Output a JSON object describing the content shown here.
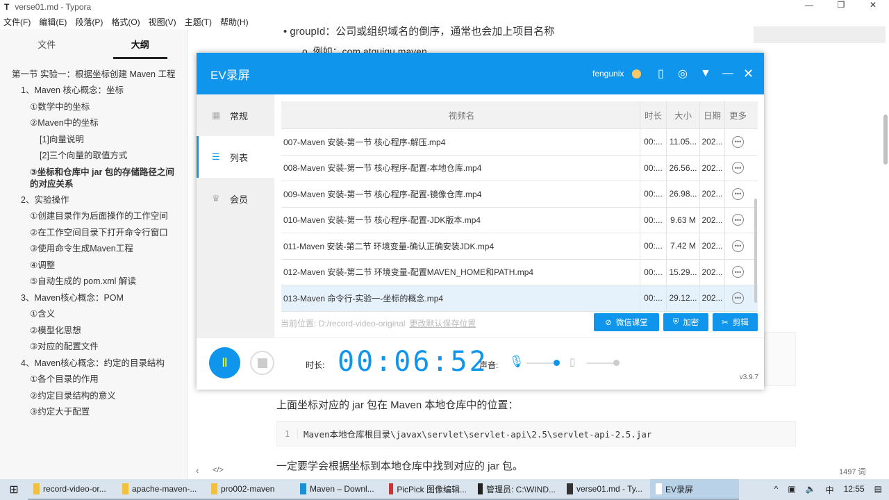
{
  "window": {
    "title": "verse01.md - Typora",
    "icon": "T",
    "controls": [
      "—",
      "❐",
      "✕"
    ]
  },
  "menu": [
    "文件(F)",
    "编辑(E)",
    "段落(P)",
    "格式(O)",
    "视图(V)",
    "主题(T)",
    "帮助(H)"
  ],
  "sidebar": {
    "tabs": [
      "文件",
      "大纲"
    ],
    "active_tab": 1,
    "outline": [
      {
        "text": "第一节 实验一：根据坐标创建 Maven 工程",
        "level": 1,
        "style": "wrap"
      },
      {
        "text": "1、Maven 核心概念：坐标",
        "level": 2
      },
      {
        "text": "①数学中的坐标",
        "level": 3
      },
      {
        "text": "②Maven中的坐标",
        "level": 3
      },
      {
        "text": "[1]向量说明",
        "level": 4
      },
      {
        "text": "[2]三个向量的取值方式",
        "level": 4
      },
      {
        "text": "③坐标和仓库中 jar 包的存储路径之间的对应关系",
        "level": 3,
        "style": "bold"
      },
      {
        "text": "2、实验操作",
        "level": 2
      },
      {
        "text": "①创建目录作为后面操作的工作空间",
        "level": 3
      },
      {
        "text": "②在工作空间目录下打开命令行窗口",
        "level": 3
      },
      {
        "text": "③使用命令生成Maven工程",
        "level": 3
      },
      {
        "text": "④调整",
        "level": 3
      },
      {
        "text": "⑤自动生成的 pom.xml 解读",
        "level": 3
      },
      {
        "text": "3、Maven核心概念：POM",
        "level": 2
      },
      {
        "text": "①含义",
        "level": 3
      },
      {
        "text": "②模型化思想",
        "level": 3
      },
      {
        "text": "③对应的配置文件",
        "level": 3
      },
      {
        "text": "4、Maven核心概念：约定的目录结构",
        "level": 2
      },
      {
        "text": "①各个目录的作用",
        "level": 3
      },
      {
        "text": "②约定目录结构的意义",
        "level": 3
      },
      {
        "text": "③约定大于配置",
        "level": 3
      }
    ]
  },
  "editor": {
    "bullet": "groupId：公司或组织域名的倒序，通常也会加上项目名称",
    "sub_bullet": "例如：com.atguigu.maven",
    "para1": "上面坐标对应的 jar 包在 Maven 本地仓库中的位置：",
    "code_line_no": "1",
    "code": "Maven本地仓库根目录\\javax\\servlet\\servlet-api\\2.5\\servlet-api-2.5.jar",
    "para2": "一定要学会根据坐标到本地仓库中找到对应的 jar 包。",
    "word_count": "1497 词",
    "footer_icons": [
      "‹",
      "</>"
    ]
  },
  "ev": {
    "title": "EV录屏",
    "user": "fengunix",
    "nav": [
      "常规",
      "列表",
      "会员"
    ],
    "active_nav": 1,
    "columns": [
      "视频名",
      "时长",
      "大小",
      "日期",
      "更多"
    ],
    "rows": [
      {
        "name": "007-Maven 安装-第一节 核心程序-解压.mp4",
        "dur": "00:...",
        "size": "11.05...",
        "date": "202..."
      },
      {
        "name": "008-Maven 安装-第一节 核心程序-配置-本地仓库.mp4",
        "dur": "00:...",
        "size": "26.56...",
        "date": "202..."
      },
      {
        "name": "009-Maven 安装-第一节 核心程序-配置-镜像仓库.mp4",
        "dur": "00:...",
        "size": "26.98...",
        "date": "202..."
      },
      {
        "name": "010-Maven 安装-第一节 核心程序-配置-JDK版本.mp4",
        "dur": "00:...",
        "size": "9.63 M",
        "date": "202..."
      },
      {
        "name": "011-Maven 安装-第二节 环境变量-确认正确安装JDK.mp4",
        "dur": "00:...",
        "size": "7.42 M",
        "date": "202..."
      },
      {
        "name": "012-Maven 安装-第二节 环境变量-配置MAVEN_HOME和PATH.mp4",
        "dur": "00:...",
        "size": "15.29...",
        "date": "202..."
      },
      {
        "name": "013-Maven 命令行-实验一-坐标的概念.mp4",
        "dur": "00:...",
        "size": "29.12...",
        "date": "202..."
      }
    ],
    "location_label": "当前位置:",
    "location": "D:/record-video-original",
    "change_location": "更改默认保存位置",
    "buttons": [
      "微信课堂",
      "加密",
      "剪辑"
    ],
    "duration_label": "时长:",
    "timer": "00:06:52",
    "sound_label": "声音:",
    "mic_level": 0.9,
    "speaker_level": 0.9,
    "version": "v3.9.7"
  },
  "taskbar": {
    "items": [
      "record-video-or...",
      "apache-maven-...",
      "pro002-maven",
      "Maven – Downl...",
      "PicPick 图像编辑...",
      "管理员: C:\\WIND...",
      "verse01.md - Ty...",
      "EV录屏"
    ],
    "active": 7,
    "ime": "中",
    "time": "12:55"
  }
}
